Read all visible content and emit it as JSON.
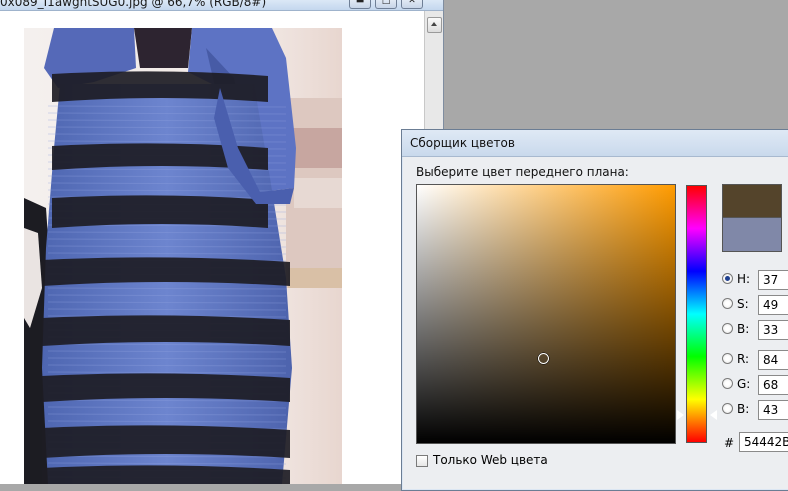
{
  "document_window": {
    "title": "0x089_I1awghtSUG0.jpg @ 66,7% (RGB/8#)",
    "controls": [
      "minimize-icon",
      "maximize-icon",
      "close-icon"
    ]
  },
  "color_picker": {
    "title": "Сборщик цветов",
    "prompt_label": "Выберите цвет переднего плана:",
    "new_color": "#54442B",
    "current_color": "#8088A8",
    "fields": {
      "hsb": [
        {
          "label": "H:",
          "value": "37",
          "checked": true
        },
        {
          "label": "S:",
          "value": "49",
          "checked": false
        },
        {
          "label": "B:",
          "value": "33",
          "checked": false
        }
      ],
      "rgb": [
        {
          "label": "R:",
          "value": "84",
          "checked": false
        },
        {
          "label": "G:",
          "value": "68",
          "checked": false
        },
        {
          "label": "B:",
          "value": "43",
          "checked": false
        }
      ]
    },
    "hex_label": "#",
    "hex_value": "54442B",
    "web_only_label": "Только Web цвета",
    "web_only_checked": false,
    "hue_level": 0.1
  },
  "colors": {
    "hue_base": "#ff9b00",
    "dress_blue": "#5b73bf",
    "lace_dark": "#1d1c24"
  }
}
